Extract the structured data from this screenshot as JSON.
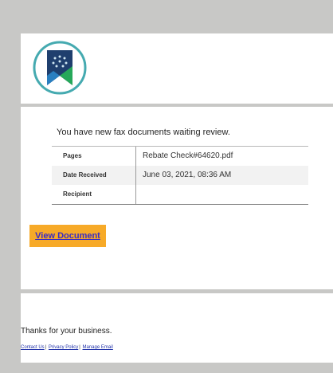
{
  "email": {
    "message": "You have new fax documents waiting review.",
    "details": [
      {
        "label": "Pages",
        "value": "Rebate Check#64620.pdf"
      },
      {
        "label": "Date Received",
        "value": "June 03, 2021, 08:36 AM"
      },
      {
        "label": "Recipient",
        "value": ""
      }
    ],
    "cta_label": "View Document"
  },
  "footer": {
    "thanks": "Thanks for your business.",
    "links": [
      "Contact Us",
      "Privacy Policy",
      "Manage Email"
    ],
    "separator": "|"
  },
  "colors": {
    "cta_bg": "#f7aa28",
    "cta_text": "#3a2cc4",
    "logo_ring": "#45aab0",
    "logo_bookmark_dark": "#1f3f6e",
    "logo_bookmark_green": "#26a85a",
    "page_bg": "#c8c8c6"
  },
  "icons": {
    "logo": "bookmark-shield-logo-icon"
  }
}
